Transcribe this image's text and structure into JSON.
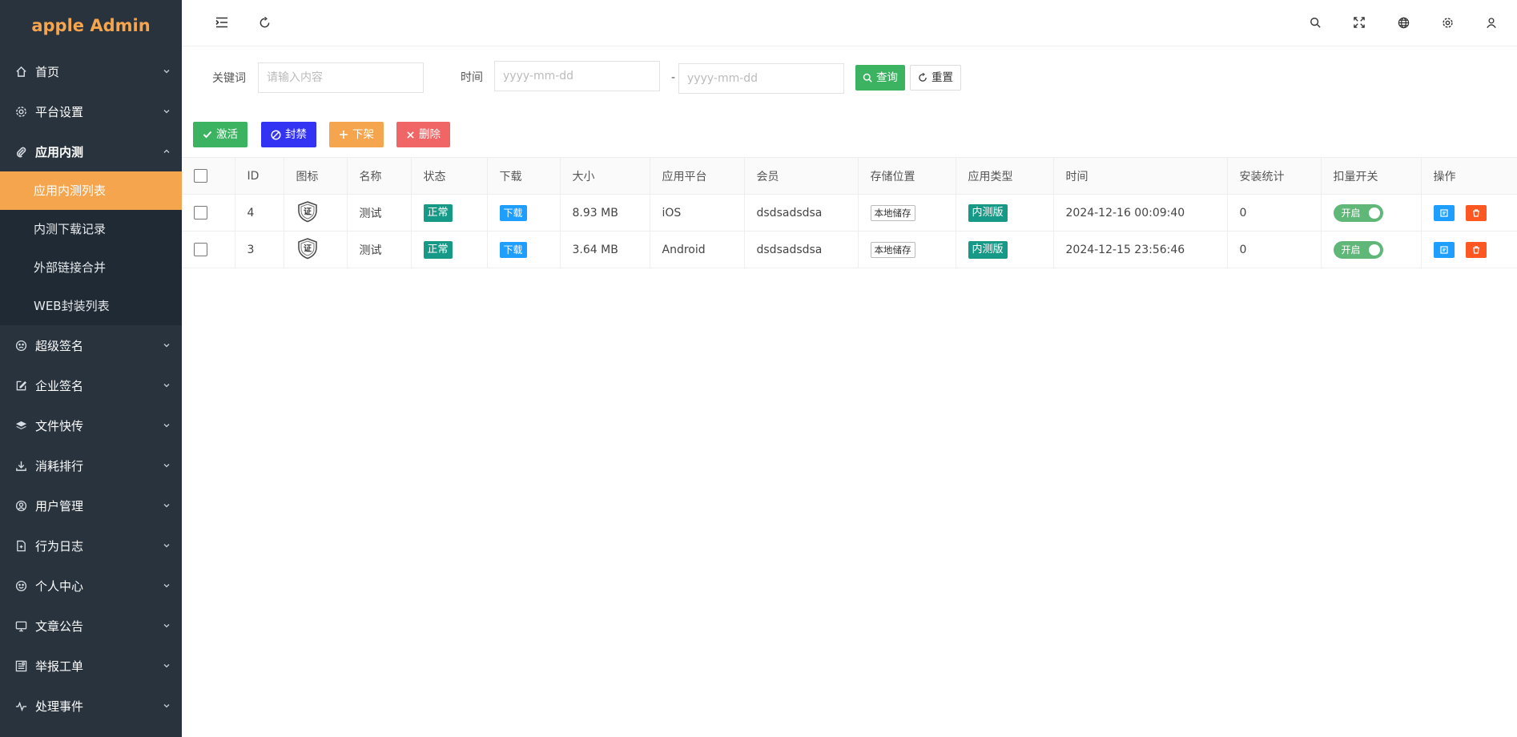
{
  "app": {
    "title": "apple Admin"
  },
  "sidebar": {
    "items": [
      {
        "label": "首页",
        "icon": "home-icon"
      },
      {
        "label": "平台设置",
        "icon": "gear-icon"
      },
      {
        "label": "应用内测",
        "icon": "paperclip-icon",
        "open": true,
        "children": [
          {
            "label": "应用内测列表",
            "active": true
          },
          {
            "label": "内测下载记录"
          },
          {
            "label": "外部链接合并"
          },
          {
            "label": "WEB封装列表"
          }
        ]
      },
      {
        "label": "超级签名",
        "icon": "face-icon"
      },
      {
        "label": "企业签名",
        "icon": "edit-icon"
      },
      {
        "label": "文件快传",
        "icon": "layers-icon"
      },
      {
        "label": "消耗排行",
        "icon": "download-icon"
      },
      {
        "label": "用户管理",
        "icon": "user-circle-icon"
      },
      {
        "label": "行为日志",
        "icon": "file-icon"
      },
      {
        "label": "个人中心",
        "icon": "smile-icon"
      },
      {
        "label": "文章公告",
        "icon": "monitor-icon"
      },
      {
        "label": "举报工单",
        "icon": "report-icon"
      },
      {
        "label": "处理事件",
        "icon": "pulse-icon"
      }
    ]
  },
  "search": {
    "keyword_label": "关键词",
    "keyword_placeholder": "请输入内容",
    "time_label": "时间",
    "date_from_placeholder": "yyyy-mm-dd",
    "date_separator": "-",
    "date_to_placeholder": "yyyy-mm-dd",
    "query_label": "查询",
    "reset_label": "重置"
  },
  "toolbar": {
    "activate_label": "激活",
    "ban_label": "封禁",
    "unlist_label": "下架",
    "delete_label": "删除"
  },
  "table": {
    "headers": [
      "ID",
      "图标",
      "名称",
      "状态",
      "下载",
      "大小",
      "应用平台",
      "会员",
      "存储位置",
      "应用类型",
      "时间",
      "安装统计",
      "扣量开关",
      "操作"
    ],
    "rows": [
      {
        "id": "4",
        "icon_text": "证",
        "name": "测试",
        "status": "正常",
        "download": "下载",
        "size": "8.93 MB",
        "platform": "iOS",
        "member": "dsdsadsdsa",
        "storage": "本地储存",
        "type": "内测版",
        "time": "2024-12-16 00:09:40",
        "installs": "0",
        "switch": "开启"
      },
      {
        "id": "3",
        "icon_text": "证",
        "name": "测试",
        "status": "正常",
        "download": "下载",
        "size": "3.64 MB",
        "platform": "Android",
        "member": "dsdsadsdsa",
        "storage": "本地储存",
        "type": "内测版",
        "time": "2024-12-15 23:56:46",
        "installs": "0",
        "switch": "开启"
      }
    ]
  },
  "colors": {
    "sidebar_bg": "#28333e",
    "accent": "#f5a54d",
    "green": "#4caf50",
    "blue": "#1e9fff",
    "teal": "#169a87"
  }
}
